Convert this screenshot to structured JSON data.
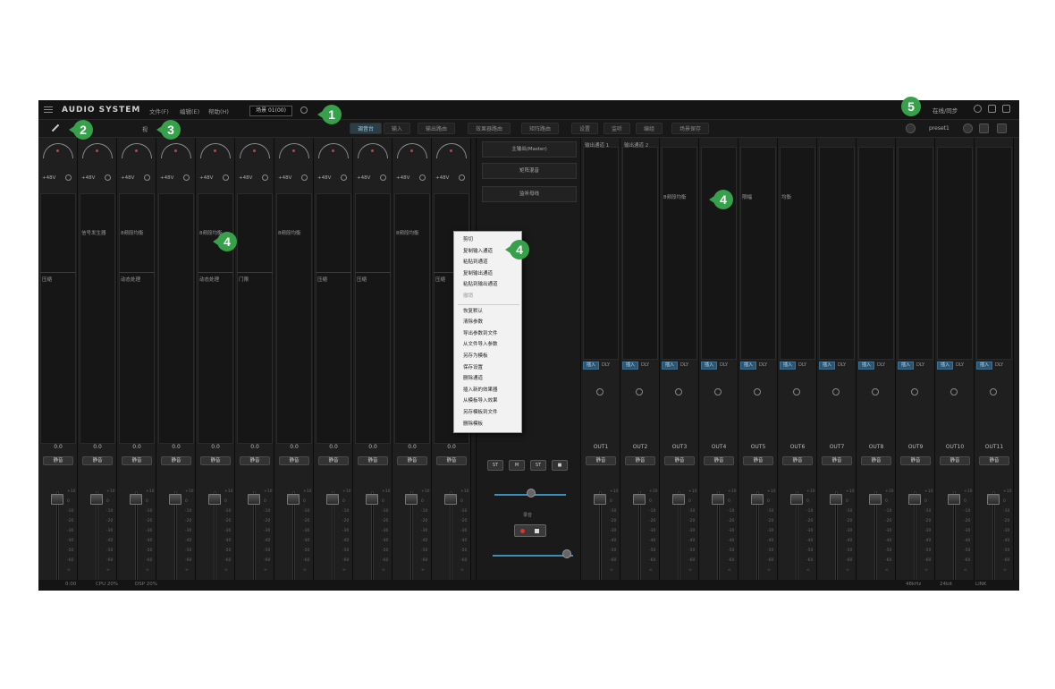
{
  "titlebar": {
    "app_title": "AUDIO SYSTEM",
    "menu": [
      "文件(F)",
      "编辑(E)",
      "帮助(H)"
    ],
    "scene": "场景 01(00)",
    "right_status": "在线/同步"
  },
  "toolbar": {
    "view_label": "视",
    "preset_label": "preset1",
    "tabs": [
      "调音台",
      "输入",
      "输出路由",
      "效果器路由",
      "矩阵路由",
      "设置",
      "监听",
      "编组",
      "场景保存"
    ]
  },
  "left_channels": [
    {
      "gain": "+48V",
      "label_a": "",
      "label_b": "压缩",
      "value": "0.0",
      "solo": "静音",
      "fader": "0.0",
      "num": "1"
    },
    {
      "gain": "+48V",
      "label_a": "信号发生器",
      "label_b": "",
      "value": "0.0",
      "solo": "静音",
      "fader": "0.0",
      "num": "2"
    },
    {
      "gain": "+48V",
      "label_a": "8频段均衡",
      "label_b": "动态处理",
      "value": "0.0",
      "solo": "静音",
      "fader": "0.0",
      "num": "3"
    },
    {
      "gain": "+48V",
      "label_a": "",
      "label_b": "",
      "value": "0.0",
      "solo": "静音",
      "fader": "0.0",
      "num": "4"
    },
    {
      "gain": "+48V",
      "label_a": "8频段均衡",
      "label_b": "动态处理",
      "value": "0.0",
      "solo": "静音",
      "fader": "0.0",
      "num": "5"
    },
    {
      "gain": "+48V",
      "label_a": "",
      "label_b": "门限",
      "value": "0.0",
      "solo": "静音",
      "fader": "0.0",
      "num": "6"
    },
    {
      "gain": "+48V",
      "label_a": "8频段均衡",
      "label_b": "",
      "value": "0.0",
      "solo": "静音",
      "fader": "0.0",
      "num": "7"
    },
    {
      "gain": "+48V",
      "label_a": "",
      "label_b": "压缩",
      "value": "0.0",
      "solo": "静音",
      "fader": "0.0",
      "num": "8"
    },
    {
      "gain": "+48V",
      "label_a": "",
      "label_b": "压缩",
      "value": "0.0",
      "solo": "静音",
      "fader": "0.0",
      "num": "9"
    },
    {
      "gain": "+48V",
      "label_a": "8频段均衡",
      "label_b": "",
      "value": "0.0",
      "solo": "静音",
      "fader": "0.0",
      "num": "10"
    },
    {
      "gain": "+48V",
      "label_a": "",
      "label_b": "压缩",
      "value": "0.0",
      "solo": "静音",
      "fader": "0.0",
      "num": "11"
    }
  ],
  "right_channels": [
    {
      "top": "输出通道 1",
      "mid": "",
      "ins_a": "插入",
      "ins_b": "DLY",
      "value": "OUT1",
      "solo": "静音",
      "fader": "0.0",
      "num": "1"
    },
    {
      "top": "输出通道 2",
      "mid": "",
      "ins_a": "插入",
      "ins_b": "DLY",
      "value": "OUT2",
      "solo": "静音",
      "fader": "0.0",
      "num": "2"
    },
    {
      "top": "",
      "mid": "8频段均衡",
      "ins_a": "插入",
      "ins_b": "DLY",
      "value": "OUT3",
      "solo": "静音",
      "fader": "0.0",
      "num": "3"
    },
    {
      "top": "",
      "mid": "",
      "ins_a": "插入",
      "ins_b": "DLY",
      "value": "OUT4",
      "solo": "静音",
      "fader": "0.0",
      "num": "4"
    },
    {
      "top": "",
      "mid": "限幅",
      "ins_a": "插入",
      "ins_b": "DLY",
      "value": "OUT5",
      "solo": "静音",
      "fader": "0.0",
      "num": "5"
    },
    {
      "top": "",
      "mid": "均衡",
      "ins_a": "插入",
      "ins_b": "DLY",
      "value": "OUT6",
      "solo": "静音",
      "fader": "0.0",
      "num": "6"
    },
    {
      "top": "",
      "mid": "",
      "ins_a": "插入",
      "ins_b": "DLY",
      "value": "OUT7",
      "solo": "静音",
      "fader": "0.0",
      "num": "7"
    },
    {
      "top": "",
      "mid": "",
      "ins_a": "插入",
      "ins_b": "DLY",
      "value": "OUT8",
      "solo": "静音",
      "fader": "0.0",
      "num": "8"
    },
    {
      "top": "",
      "mid": "",
      "ins_a": "插入",
      "ins_b": "DLY",
      "value": "OUT9",
      "solo": "静音",
      "fader": "0.0",
      "num": "9"
    },
    {
      "top": "",
      "mid": "",
      "ins_a": "插入",
      "ins_b": "DLY",
      "value": "OUT10",
      "solo": "静音",
      "fader": "0.0",
      "num": "10"
    },
    {
      "top": "",
      "mid": "",
      "ins_a": "插入",
      "ins_b": "DLY",
      "value": "OUT11",
      "solo": "静音",
      "fader": "0.0",
      "num": "11"
    }
  ],
  "center": {
    "boxes": [
      "主输出(Master)",
      "矩阵混音",
      "监听母线"
    ],
    "buttons": [
      "ST",
      "M",
      "ST",
      "■"
    ],
    "rec_label": "录音"
  },
  "context_menu": {
    "items": [
      "剪切",
      "复制输入通道",
      "粘贴到通道",
      "复制输出通道",
      "粘贴到输出通道",
      "撤销",
      "恢复默认",
      "清除参数",
      "导出参数到文件",
      "从文件导入参数",
      "另存为模板",
      "保存设置",
      "删除通道",
      "插入新的效果器",
      "从模板导入效果",
      "另存模板到文件",
      "删除模板"
    ],
    "disabled": [
      5
    ]
  },
  "bottom_status": [
    "0:00",
    "CPU 20%",
    "DSP 20%",
    "48kHz",
    "24bit",
    "LINK"
  ],
  "callouts": [
    "1",
    "2",
    "3",
    "4",
    "4",
    "4",
    "5"
  ],
  "colors": {
    "accent": "#36a14a",
    "panel": "#1c1c1c",
    "insert": "#2b5570"
  }
}
